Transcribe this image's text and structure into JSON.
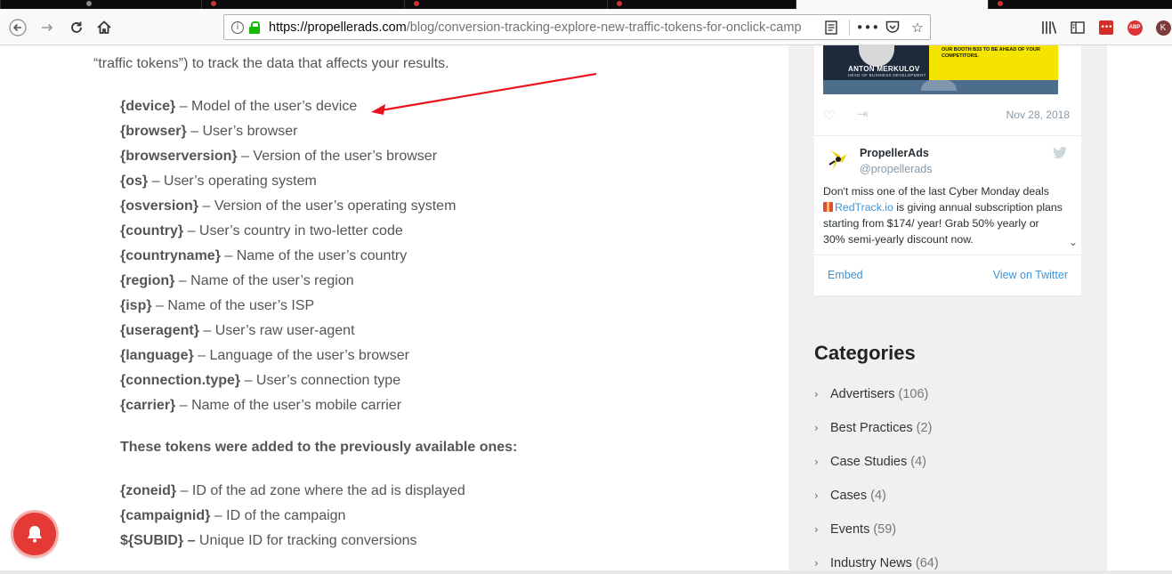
{
  "browser": {
    "url_domain": "https://propellerads.com",
    "url_path": "/blog/conversion-tracking-explore-new-traffic-tokens-for-onclick-camp",
    "icons": [
      "back-arrow-icon",
      "forward-arrow-icon",
      "reload-icon",
      "home-icon",
      "info-icon",
      "lock-icon",
      "reader-view-icon",
      "more-actions-icon",
      "pocket-icon",
      "bookmark-star-icon",
      "library-icon",
      "sidebar-icon",
      "lastpass-icon",
      "adblock-icon",
      "profile-icon"
    ],
    "abp_label": "ABP",
    "avatar_letter": "K",
    "lastpass_label": "•••"
  },
  "article": {
    "intro": "“traffic tokens”) to track the data that affects your results.",
    "tokens": [
      {
        "token": "{device}",
        "desc": " – Model of the user’s device"
      },
      {
        "token": "{browser}",
        "desc": " – User’s browser"
      },
      {
        "token": "{browserversion}",
        "desc": " – Version of the user’s browser"
      },
      {
        "token": "{os}",
        "desc": " – User’s operating system"
      },
      {
        "token": "{osversion}",
        "desc": " – Version of the user’s operating system"
      },
      {
        "token": "{country}",
        "desc": " – User’s country in two-letter code"
      },
      {
        "token": "{countryname}",
        "desc": " – Name of the user’s country"
      },
      {
        "token": "{region}",
        "desc": " – Name of the user’s region"
      },
      {
        "token": "{isp}",
        "desc": " – Name of the user’s ISP"
      },
      {
        "token": "{useragent}",
        "desc": " – User’s raw user-agent"
      },
      {
        "token": "{language}",
        "desc": " – Language of the user’s browser"
      },
      {
        "token": "{connection.type}",
        "desc": " – User’s connection type"
      },
      {
        "token": "{carrier}",
        "desc": " – Name of the user’s mobile carrier"
      }
    ],
    "subheading": "These tokens were added to the previously available ones:",
    "tokens2": [
      {
        "token": "{zoneid}",
        "desc": " – ID of the ad zone where the ad is displayed"
      },
      {
        "token": "{campaignid}",
        "desc": " – ID of the campaign"
      },
      {
        "token": "${SUBID} –",
        "desc": " Unique ID for tracking conversions"
      }
    ],
    "annotation_color": "#e8141b"
  },
  "tweet": {
    "banner_name": "ANTON MERKULOV",
    "banner_role": "HEAD OF BUSINESS DEVELOPMENT",
    "banner_tagline": "OUR BOOTH B33 TO BE AHEAD OF YOUR COMPETITORS.",
    "date": "Nov 28, 2018",
    "author": "PropellerAds",
    "handle": "@propellerads",
    "text_before": "Don't miss one of the last Cyber Monday deals ",
    "link": "RedTrack.io",
    "text_after": " is giving annual subscription plans starting from $174/ year! Grab 50% yearly or 30% semi-yearly discount now.",
    "embed": "Embed",
    "view": "View on Twitter"
  },
  "categories": {
    "title": "Categories",
    "items": [
      {
        "label": "Advertisers",
        "count": "(106)"
      },
      {
        "label": "Best Practices",
        "count": "(2)"
      },
      {
        "label": "Case Studies",
        "count": "(4)"
      },
      {
        "label": "Cases",
        "count": "(4)"
      },
      {
        "label": "Events",
        "count": "(59)"
      },
      {
        "label": "Industry News",
        "count": "(64)"
      }
    ]
  },
  "colors": {
    "bell": "#e53935",
    "link": "#3b94d9",
    "secure_lock": "#12bc00"
  }
}
